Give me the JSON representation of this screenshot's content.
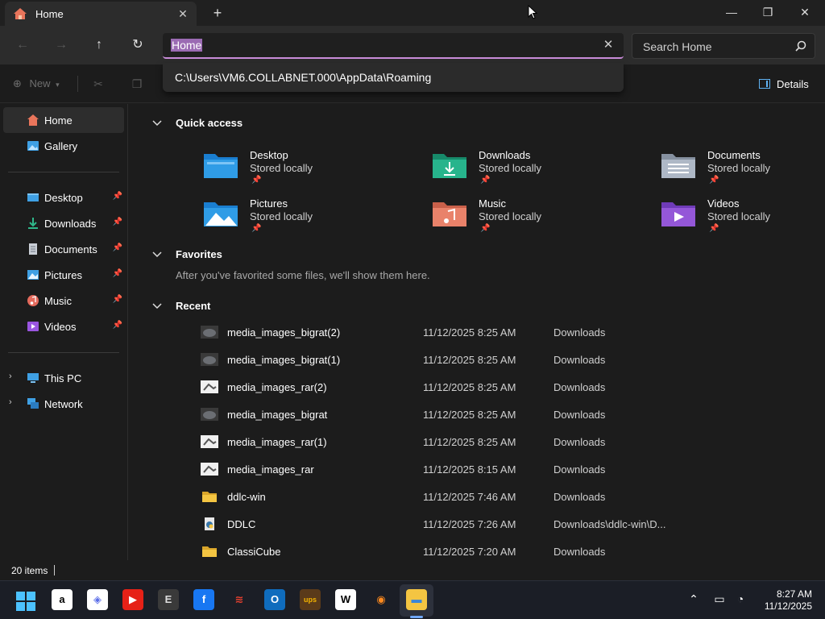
{
  "tab": {
    "title": "Home",
    "close": "✕"
  },
  "new_tab": "+",
  "window_controls": {
    "minimize": "—",
    "maximize": "❐",
    "close": "✕"
  },
  "address": {
    "value": "Home",
    "clear": "✕"
  },
  "search": {
    "placeholder": "Search Home"
  },
  "suggestion": "C:\\Users\\VM6.COLLABNET.000\\AppData\\Roaming",
  "commandbar": {
    "new_label": "New",
    "details_label": "Details"
  },
  "sidebar": {
    "items": [
      {
        "label": "Home",
        "icon": "home-icon",
        "color": "#e9755b"
      },
      {
        "label": "Gallery",
        "icon": "gallery-icon",
        "color": "#3fa0e4"
      },
      {
        "label": "Desktop",
        "icon": "desktop-icon",
        "color": "#3fa0e4",
        "pinned": "📌"
      },
      {
        "label": "Downloads",
        "icon": "downloads-icon",
        "color": "#2fb78a",
        "pinned": "📌"
      },
      {
        "label": "Documents",
        "icon": "documents-icon",
        "color": "#c9ced6",
        "pinned": "📌"
      },
      {
        "label": "Pictures",
        "icon": "pictures-icon",
        "color": "#3fa0e4",
        "pinned": "📌"
      },
      {
        "label": "Music",
        "icon": "music-icon",
        "color": "#e46a5c",
        "pinned": "📌"
      },
      {
        "label": "Videos",
        "icon": "videos-icon",
        "color": "#9a55e0",
        "pinned": "📌"
      },
      {
        "label": "This PC",
        "icon": "this-pc-icon",
        "color": "#3fa0e4",
        "chevron": "›"
      },
      {
        "label": "Network",
        "icon": "network-icon",
        "color": "#3fa0e4",
        "chevron": "›"
      }
    ]
  },
  "sections": {
    "quick_access": "Quick access",
    "favorites": "Favorites",
    "favorites_note": "After you've favorited some files, we'll show them here.",
    "recent": "Recent"
  },
  "quick_access": [
    {
      "name": "Desktop",
      "sub": "Stored locally",
      "icon": "desktop-folder-icon",
      "color": "#2f9ce6"
    },
    {
      "name": "Downloads",
      "sub": "Stored locally",
      "icon": "downloads-folder-icon",
      "color": "#27b48c"
    },
    {
      "name": "Documents",
      "sub": "Stored locally",
      "icon": "documents-folder-icon",
      "color": "#aeb8c6"
    },
    {
      "name": "Pictures",
      "sub": "Stored locally",
      "icon": "pictures-folder-icon",
      "color": "#2f9ce6"
    },
    {
      "name": "Music",
      "sub": "Stored locally",
      "icon": "music-folder-icon",
      "color": "#e9826a"
    },
    {
      "name": "Videos",
      "sub": "Stored locally",
      "icon": "videos-folder-icon",
      "color": "#9457d8"
    }
  ],
  "pin_glyph": "📌",
  "recent": [
    {
      "name": "media_images_bigrat(2)",
      "date": "11/12/2025 8:25 AM",
      "location": "Downloads",
      "icon": "image-thumb-icon"
    },
    {
      "name": "media_images_bigrat(1)",
      "date": "11/12/2025 8:25 AM",
      "location": "Downloads",
      "icon": "image-thumb-icon"
    },
    {
      "name": "media_images_rar(2)",
      "date": "11/12/2025 8:25 AM",
      "location": "Downloads",
      "icon": "image-thumb-icon"
    },
    {
      "name": "media_images_bigrat",
      "date": "11/12/2025 8:25 AM",
      "location": "Downloads",
      "icon": "image-thumb-icon"
    },
    {
      "name": "media_images_rar(1)",
      "date": "11/12/2025 8:25 AM",
      "location": "Downloads",
      "icon": "image-thumb-icon"
    },
    {
      "name": "media_images_rar",
      "date": "11/12/2025 8:15 AM",
      "location": "Downloads",
      "icon": "image-thumb-icon"
    },
    {
      "name": "ddlc-win",
      "date": "11/12/2025 7:46 AM",
      "location": "Downloads",
      "icon": "folder-icon"
    },
    {
      "name": "DDLC",
      "date": "11/12/2025 7:26 AM",
      "location": "Downloads\\ddlc-win\\D...",
      "icon": "python-file-icon"
    },
    {
      "name": "ClassiCube",
      "date": "11/12/2025 7:20 AM",
      "location": "Downloads",
      "icon": "folder-icon"
    }
  ],
  "status": {
    "items": "20 items"
  },
  "taskbar": {
    "apps": [
      {
        "name": "amazon-app-icon",
        "glyph": "a",
        "bg": "#ffffff",
        "fg": "#000000"
      },
      {
        "name": "copilot-app-icon",
        "glyph": "◈",
        "bg": "#ffffff",
        "fg": "#5b6ee8"
      },
      {
        "name": "youtube-app-icon",
        "glyph": "▶",
        "bg": "#e62117",
        "fg": "#ffffff"
      },
      {
        "name": "epic-games-app-icon",
        "glyph": "E",
        "bg": "#3a3a3a",
        "fg": "#dddddd"
      },
      {
        "name": "facebook-app-icon",
        "glyph": "f",
        "bg": "#1877f2",
        "fg": "#ffffff"
      },
      {
        "name": "parallel-app-icon",
        "glyph": "≋",
        "bg": "#1b1e26",
        "fg": "#e6402f"
      },
      {
        "name": "outlook-app-icon",
        "glyph": "O",
        "bg": "#0f6cbd",
        "fg": "#ffffff"
      },
      {
        "name": "ups-app-icon",
        "glyph": "ups",
        "bg": "#5a3a1a",
        "fg": "#f4b400"
      },
      {
        "name": "wikipedia-app-icon",
        "glyph": "W",
        "bg": "#ffffff",
        "fg": "#000000"
      },
      {
        "name": "firefox-app-icon",
        "glyph": "◉",
        "bg": "#1b1e26",
        "fg": "#ff8a1e"
      },
      {
        "name": "file-explorer-app-icon",
        "glyph": "▬",
        "bg": "#f4c542",
        "fg": "#3a86d8"
      }
    ],
    "time": "8:27 AM",
    "date": "11/12/2025"
  }
}
